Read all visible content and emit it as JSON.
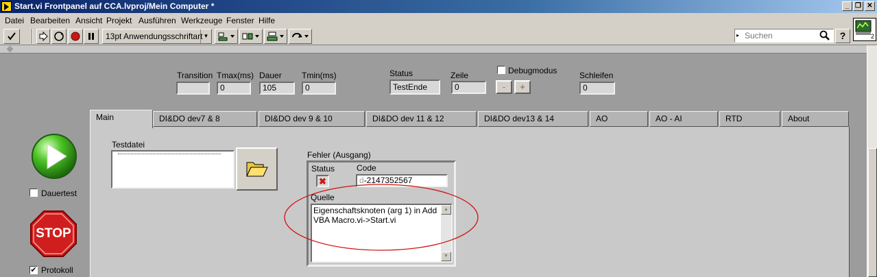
{
  "window": {
    "title": "Start.vi Frontpanel auf CCA.lvproj/Mein Computer *",
    "min_glyph": "_",
    "max_glyph": "❐",
    "close_glyph": "✕"
  },
  "menu": [
    "Datei",
    "Bearbeiten",
    "Ansicht",
    "Projekt",
    "Ausführen",
    "Werkzeuge",
    "Fenster",
    "Hilfe"
  ],
  "toolbar": {
    "font": "13pt Anwendungsschriftart",
    "search_placeholder": "Suchen",
    "help": "?",
    "vi_icon_label": "2"
  },
  "indicators": {
    "transition_label": "Transition",
    "transition_value": "",
    "tmax_label": "Tmax(ms)",
    "tmax_value": "0",
    "dauer_label": "Dauer",
    "dauer_value": "105",
    "tmin_label": "Tmin(ms)",
    "tmin_value": "0",
    "status_label": "Status",
    "status_value": "TestEnde",
    "zeile_label": "Zeile",
    "zeile_value": "0",
    "debug_label": "Debugmodus",
    "debug_checked": false,
    "minus": "-",
    "plus": "+",
    "schleifen_label": "Schleifen",
    "schleifen_value": "0"
  },
  "tabs": [
    "Main",
    "DI&DO dev7 & 8",
    "DI&DO dev 9 & 10",
    "DI&DO dev 11 & 12",
    "DI&DO dev13 & 14",
    "AO",
    "AO - AI",
    "RTD",
    "About"
  ],
  "left_panel": {
    "dauertest_label": "Dauertest",
    "dauertest_checked": false,
    "stop_label": "STOP",
    "protokoll_label": "Protokoll",
    "protokoll_checked": true,
    "checkmark": "✔"
  },
  "main": {
    "testdatei_label": "Testdatei",
    "testdatei_value": "",
    "fehler_label": "Fehler (Ausgang)",
    "status_label": "Status",
    "code_label": "Code",
    "code_prefix": "d",
    "code_value": "-2147352567",
    "quelle_label": "Quelle",
    "quelle_text": "Eigenschaftsknoten (arg 1) in Add VBA Macro.vi->Start.vi",
    "error_glyph": "✖"
  },
  "colors": {
    "panel": "#9c9c9c",
    "tab_panel": "#c9c9c9",
    "annotation": "#d01010",
    "run_button": "#3fb51c",
    "stop_button": "#d42020"
  }
}
